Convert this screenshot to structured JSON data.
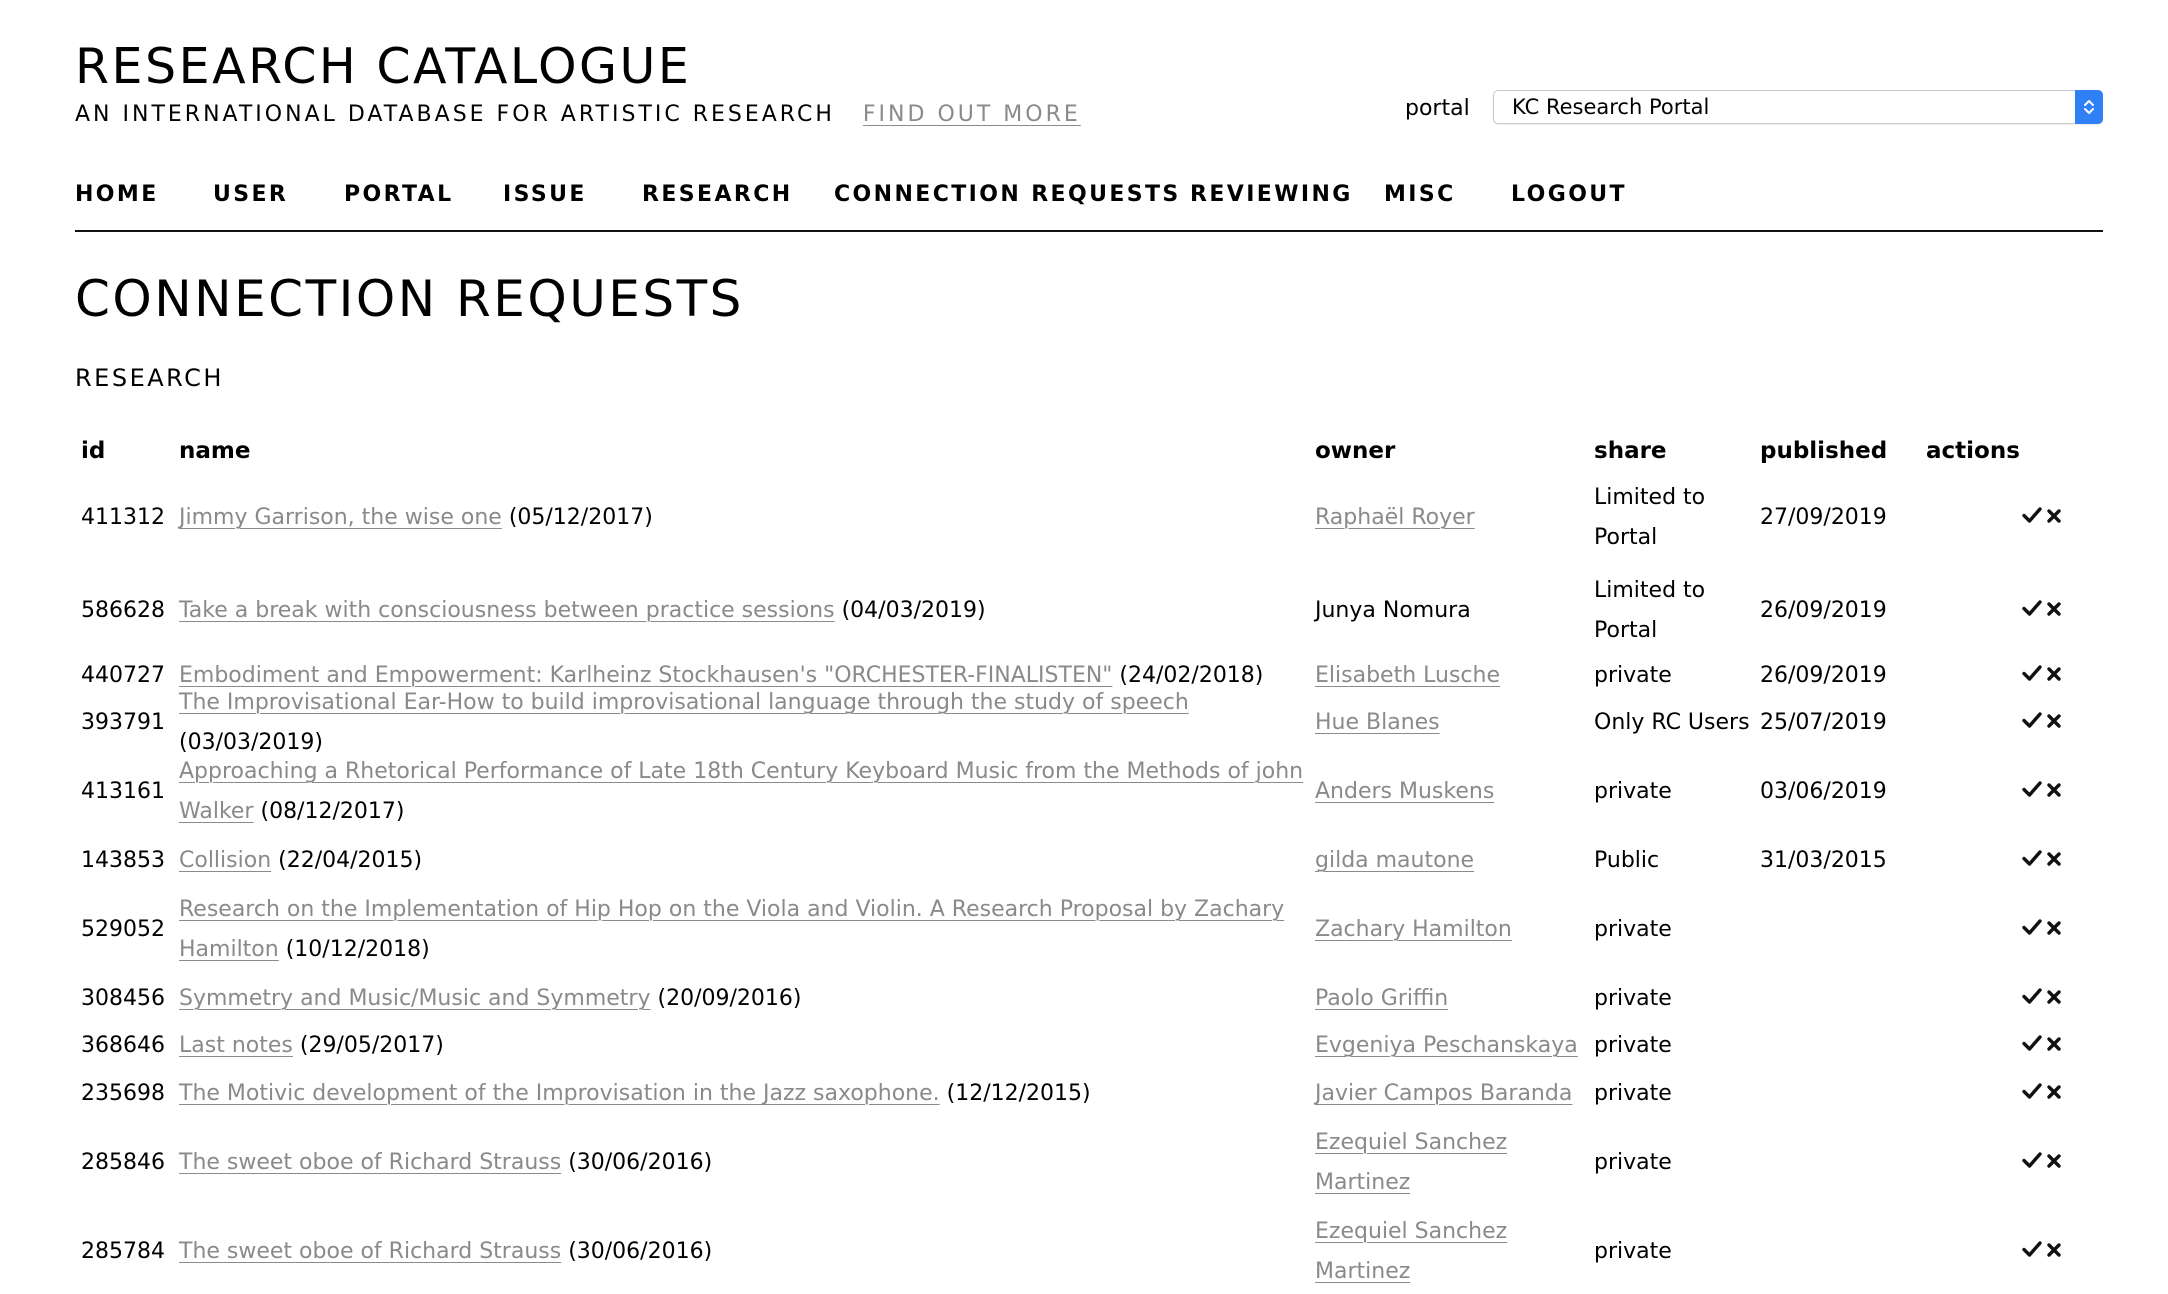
{
  "header": {
    "site_title": "RESEARCH CATALOGUE",
    "site_subtitle": "AN INTERNATIONAL DATABASE FOR ARTISTIC RESEARCH",
    "find_out_more": "FIND OUT MORE",
    "portal_label": "portal",
    "portal_selected": "KC Research Portal"
  },
  "nav": [
    "HOME",
    "USER",
    "PORTAL",
    "ISSUE",
    "RESEARCH",
    "CONNECTION REQUESTS",
    "REVIEWING",
    "MISC",
    "LOGOUT"
  ],
  "page": {
    "title": "CONNECTION REQUESTS",
    "section": "RESEARCH"
  },
  "table": {
    "headers": {
      "id": "id",
      "name": "name",
      "owner": "owner",
      "share": "share",
      "published": "published",
      "actions": "actions"
    },
    "rows": [
      {
        "id": "411312",
        "name_line1": "Jimmy Garrison, the wise one",
        "name_line2": "",
        "date": "(05/12/2017)",
        "owner_line1": "Raphaël Royer",
        "owner_line2": "",
        "owner_link": true,
        "share_line1": "Limited to",
        "share_line2": "Portal",
        "published": "27/09/2019"
      },
      {
        "id": "586628",
        "name_line1": "Take a break with consciousness between practice sessions",
        "name_line2": "",
        "date": "(04/03/2019)",
        "owner_line1": "Junya Nomura",
        "owner_line2": "",
        "owner_link": false,
        "share_line1": "Limited to",
        "share_line2": "Portal",
        "published": "26/09/2019"
      },
      {
        "id": "440727",
        "name_line1": "Embodiment and Empowerment: Karlheinz Stockhausen's \"ORCHESTER-FINALISTEN\"",
        "name_line2": "",
        "date": "(24/02/2018)",
        "owner_line1": "Elisabeth Lusche",
        "owner_line2": "",
        "owner_link": true,
        "share_line1": "private",
        "share_line2": "",
        "published": "26/09/2019"
      },
      {
        "id": "393791",
        "name_line1": "The Improvisational Ear-How to build improvisational language through the study of speech",
        "name_line2": "",
        "date": "(03/03/2019)",
        "owner_line1": "Hue Blanes",
        "owner_line2": "",
        "owner_link": true,
        "share_line1": "Only RC Users",
        "share_line2": "",
        "published": "25/07/2019"
      },
      {
        "id": "413161",
        "name_line1": "Approaching a Rhetorical Performance of Late 18th Century Keyboard Music from the Methods of john",
        "name_line2": "Walker",
        "date": "(08/12/2017)",
        "owner_line1": "Anders Muskens",
        "owner_line2": "",
        "owner_link": true,
        "share_line1": "private",
        "share_line2": "",
        "published": "03/06/2019"
      },
      {
        "id": "143853",
        "name_line1": "Collision",
        "name_line2": "",
        "date": "(22/04/2015)",
        "owner_line1": "gilda mautone",
        "owner_line2": "",
        "owner_link": true,
        "share_line1": "Public",
        "share_line2": "",
        "published": "31/03/2015"
      },
      {
        "id": "529052",
        "name_line1": "Research on the Implementation of Hip Hop on the Viola and Violin. A Research Proposal by Zachary",
        "name_line2": "Hamilton",
        "date": "(10/12/2018)",
        "owner_line1": "Zachary Hamilton",
        "owner_line2": "",
        "owner_link": true,
        "share_line1": "private",
        "share_line2": "",
        "published": ""
      },
      {
        "id": "308456",
        "name_line1": "Symmetry and Music/Music and Symmetry",
        "name_line2": "",
        "date": "(20/09/2016)",
        "owner_line1": "Paolo Griffin",
        "owner_line2": "",
        "owner_link": true,
        "share_line1": "private",
        "share_line2": "",
        "published": ""
      },
      {
        "id": "368646",
        "name_line1": "Last notes",
        "name_line2": "",
        "date": "(29/05/2017)",
        "owner_line1": "Evgeniya Peschanskaya",
        "owner_line2": "",
        "owner_link": true,
        "share_line1": "private",
        "share_line2": "",
        "published": ""
      },
      {
        "id": "235698",
        "name_line1": "The Motivic development of the Improvisation in the Jazz saxophone.",
        "name_line2": "",
        "date": "(12/12/2015)",
        "owner_line1": "Javier Campos Baranda",
        "owner_line2": "",
        "owner_link": true,
        "share_line1": "private",
        "share_line2": "",
        "published": ""
      },
      {
        "id": "285846",
        "name_line1": "The sweet oboe of Richard Strauss",
        "name_line2": "",
        "date": "(30/06/2016)",
        "owner_line1": "Ezequiel Sanchez",
        "owner_line2": "Martinez",
        "owner_link": true,
        "share_line1": "private",
        "share_line2": "",
        "published": ""
      },
      {
        "id": "285784",
        "name_line1": "The sweet oboe of Richard Strauss",
        "name_line2": "",
        "date": "(30/06/2016)",
        "owner_line1": "Ezequiel Sanchez",
        "owner_line2": "Martinez",
        "owner_link": true,
        "share_line1": "private",
        "share_line2": "",
        "published": ""
      }
    ]
  },
  "icons": {
    "accept": "checkmark-icon",
    "reject": "cross-icon",
    "select_arrows": "updown-chevron-icon"
  },
  "colors": {
    "link": "#8a8a8a",
    "select_accent": "#2f7ff5"
  }
}
